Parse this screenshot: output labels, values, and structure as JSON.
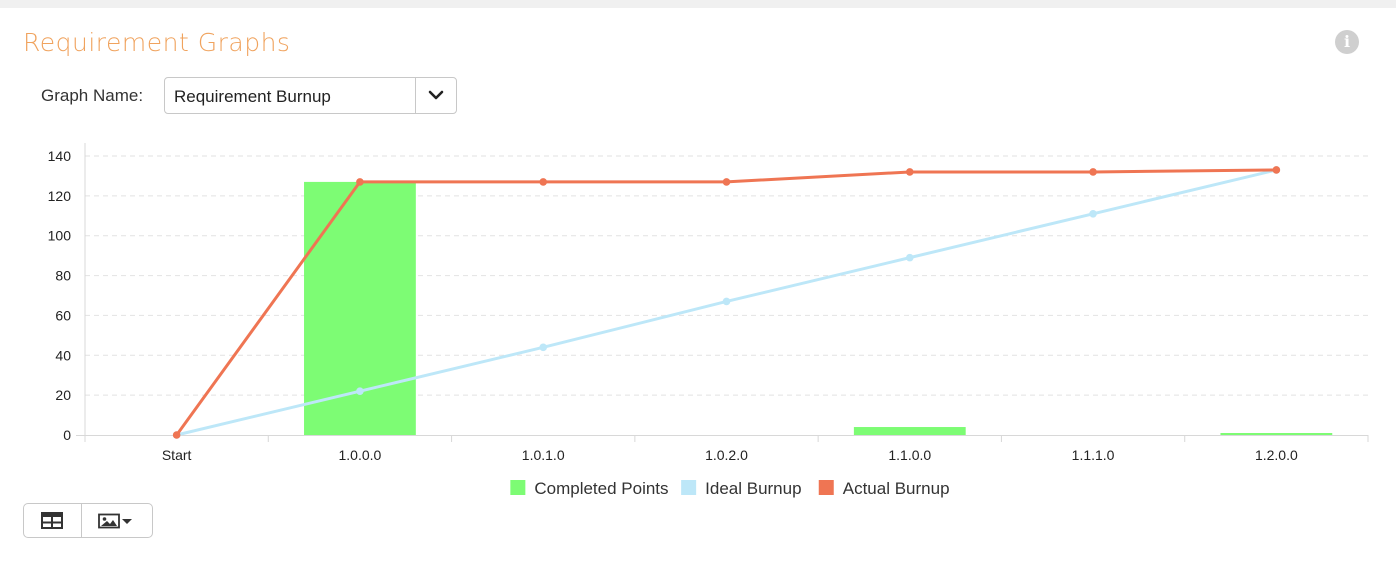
{
  "page": {
    "title": "Requirement Graphs",
    "info_icon": "info-icon"
  },
  "graph_selector": {
    "label": "Graph Name:",
    "value": "Requirement Burnup",
    "dropdown_icon": "chevron-down-icon"
  },
  "toolbar": {
    "table_icon": "table-icon",
    "image_icon": "image-icon",
    "caret_icon": "caret-down-icon"
  },
  "chart_data": {
    "type": "bar",
    "categories": [
      "Start",
      "1.0.0.0",
      "1.0.1.0",
      "1.0.2.0",
      "1.1.0.0",
      "1.1.1.0",
      "1.2.0.0"
    ],
    "ylim": [
      0,
      140
    ],
    "yticks": [
      0,
      20,
      40,
      60,
      80,
      100,
      120,
      140
    ],
    "grid": true,
    "legend_position": "bottom",
    "series": [
      {
        "name": "Completed Points",
        "type": "bar",
        "color": "#7dfc74",
        "values": [
          0,
          127,
          0,
          0,
          4,
          0,
          1
        ]
      },
      {
        "name": "Ideal Burnup",
        "type": "line",
        "color": "#bde7f8",
        "values": [
          0,
          22,
          44,
          67,
          89,
          111,
          133
        ]
      },
      {
        "name": "Actual Burnup",
        "type": "line",
        "color": "#ef7553",
        "values": [
          0,
          127,
          127,
          127,
          132,
          132,
          133
        ]
      }
    ]
  }
}
